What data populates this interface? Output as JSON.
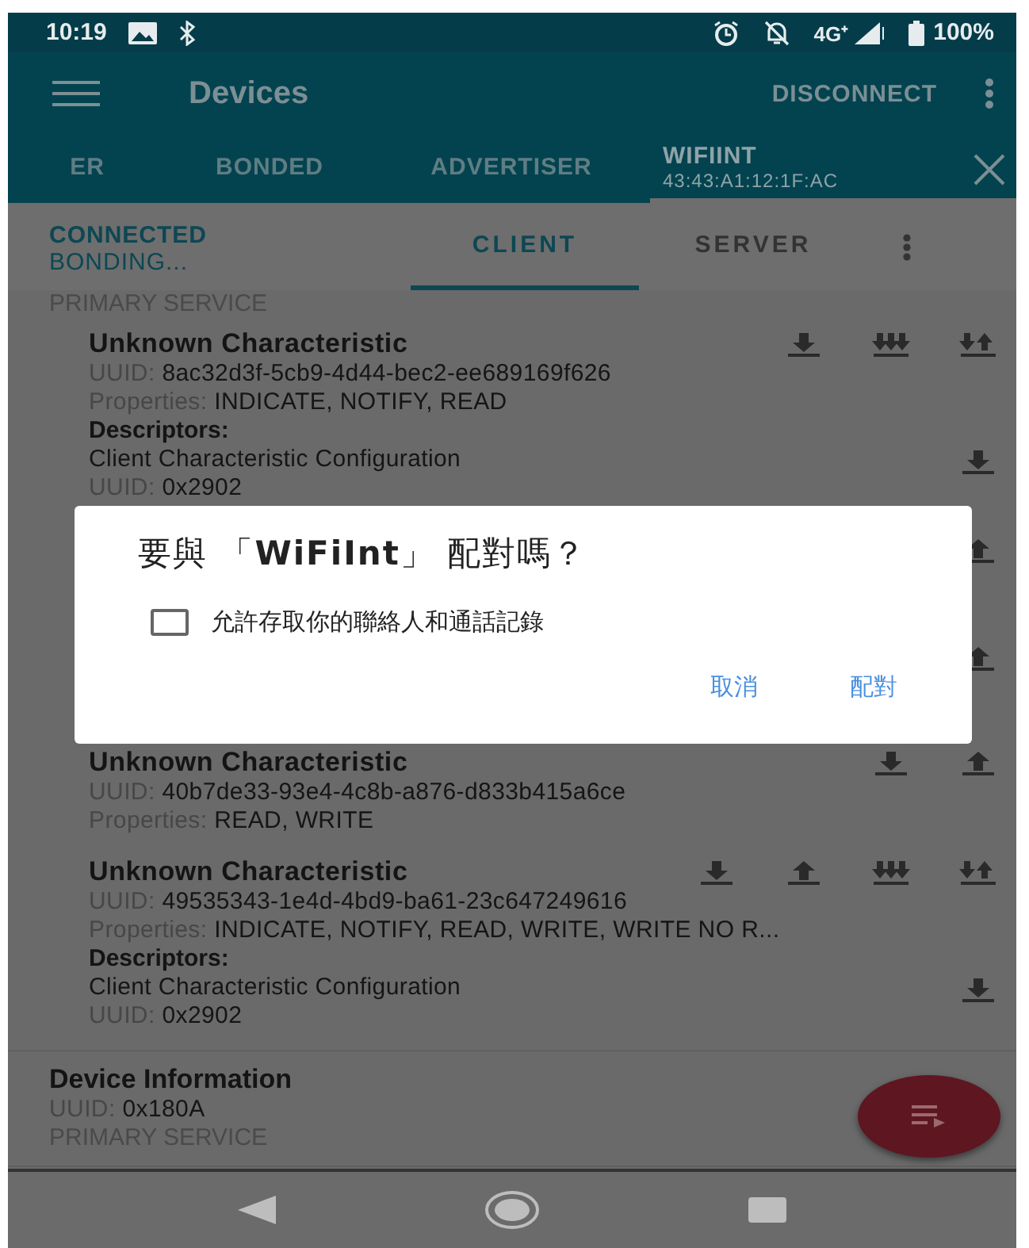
{
  "status_bar": {
    "time": "10:19",
    "network": "4G⁺",
    "battery": "100%"
  },
  "app_bar": {
    "title": "Devices",
    "action": "DISCONNECT"
  },
  "tabs": [
    {
      "label": "ER",
      "selected": false
    },
    {
      "label": "BONDED",
      "selected": false
    },
    {
      "label": "ADVERTISER",
      "selected": false
    },
    {
      "label": "WIFIINT",
      "sublabel": "43:43:A1:12:1F:AC",
      "selected": true
    }
  ],
  "connection": {
    "state": "CONNECTED",
    "bond": "BONDING..."
  },
  "subtabs": [
    {
      "label": "CLIENT",
      "selected": true
    },
    {
      "label": "SERVER",
      "selected": false
    }
  ],
  "top_service_type": "PRIMARY SERVICE",
  "characteristics_before": [
    {
      "name": "Unknown Characteristic",
      "uuid_label": "UUID:",
      "uuid": "8ac32d3f-5cb9-4d44-bec2-ee689169f626",
      "properties_label": "Properties:",
      "properties": "INDICATE, NOTIFY, READ",
      "actions": [
        {
          "kind": "read"
        },
        {
          "kind": "notify"
        },
        {
          "kind": "indicate"
        }
      ],
      "descriptors_label": "Descriptors:",
      "descriptors": [
        {
          "name": "Client Characteristic Configuration",
          "uuid_label": "UUID:",
          "uuid": "0x2902",
          "actions": [
            {
              "kind": "read"
            }
          ]
        }
      ]
    }
  ],
  "covered_rows": [
    {
      "actions": [
        {
          "kind": "write"
        }
      ]
    },
    {
      "actions": [
        {
          "kind": "write"
        }
      ]
    }
  ],
  "characteristics_after": [
    {
      "name": "Unknown Characteristic",
      "uuid_label": "UUID:",
      "uuid": "40b7de33-93e4-4c8b-a876-d833b415a6ce",
      "properties_label": "Properties:",
      "properties": "READ, WRITE",
      "actions": [
        {
          "kind": "read"
        },
        {
          "kind": "write"
        }
      ]
    },
    {
      "name": "Unknown Characteristic",
      "uuid_label": "UUID:",
      "uuid": "49535343-1e4d-4bd9-ba61-23c647249616",
      "properties_label": "Properties:",
      "properties": "INDICATE, NOTIFY, READ, WRITE, WRITE NO R...",
      "actions": [
        {
          "kind": "read"
        },
        {
          "kind": "write"
        },
        {
          "kind": "notify"
        },
        {
          "kind": "indicate"
        }
      ],
      "descriptors_label": "Descriptors:",
      "descriptors": [
        {
          "name": "Client Characteristic Configuration",
          "uuid_label": "UUID:",
          "uuid": "0x2902",
          "actions": [
            {
              "kind": "read"
            }
          ]
        }
      ]
    }
  ],
  "service": {
    "name": "Device Information",
    "uuid_label": "UUID:",
    "uuid": "0x180A",
    "type": "PRIMARY SERVICE"
  },
  "dialog": {
    "title": "要與 「**WiFiInt**」 配對嗎？",
    "checkbox": {
      "label": "允許存取你的聯絡人和通話記錄",
      "checked": false
    },
    "buttons": [
      "取消",
      "配對"
    ]
  }
}
